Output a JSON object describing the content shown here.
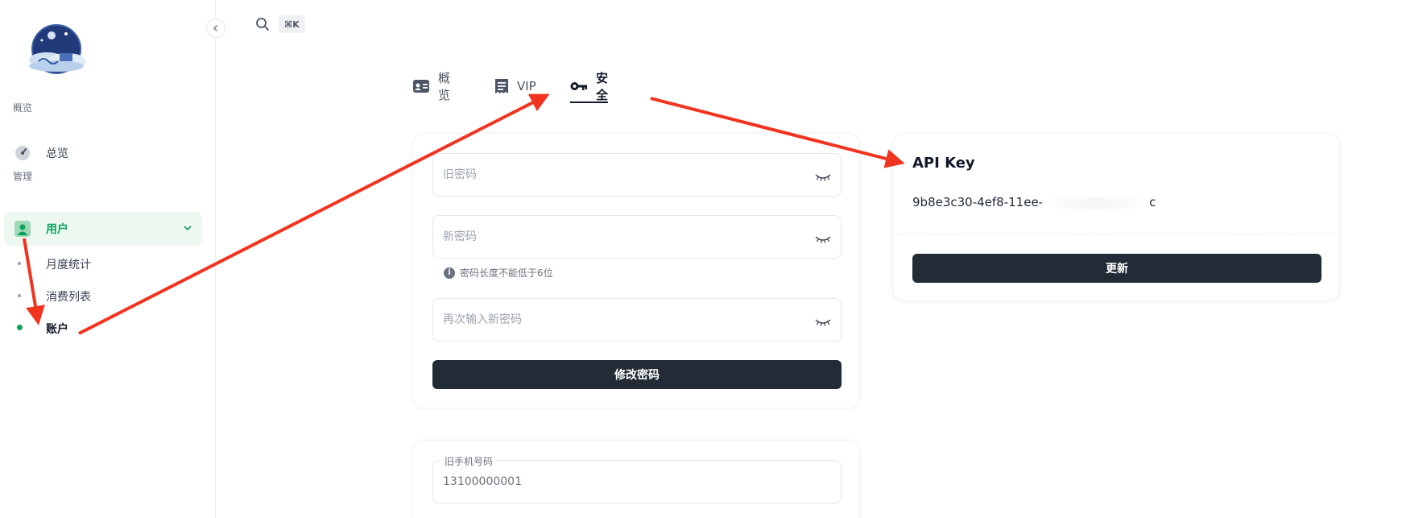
{
  "sidebar": {
    "sections": [
      {
        "label": "概览"
      },
      {
        "label": "管理"
      }
    ],
    "items": [
      {
        "label": "总览"
      },
      {
        "label": "用户"
      }
    ],
    "sub_items": [
      {
        "label": "月度统计"
      },
      {
        "label": "消费列表"
      },
      {
        "label": "账户"
      }
    ]
  },
  "topbar": {
    "shortcut": "⌘K"
  },
  "tabs": [
    {
      "label": "概览"
    },
    {
      "label": "VIP"
    },
    {
      "label": "安全"
    }
  ],
  "password_form": {
    "old_placeholder": "旧密码",
    "new_placeholder": "新密码",
    "hint": "密码长度不能低于6位",
    "confirm_placeholder": "再次输入新密码",
    "submit_label": "修改密码"
  },
  "phone_form": {
    "old_phone_label": "旧手机号码",
    "old_phone_value": "13100000001"
  },
  "api_key": {
    "title": "API Key",
    "value": "9b8e3c30-4ef8-11ee-",
    "value_tail": "c",
    "refresh_label": "更新"
  },
  "colors": {
    "accent": "#0e9f5b",
    "active_bg": "#edf8f1",
    "dark_button": "#222b36",
    "annotation_arrow": "#f0341f"
  }
}
